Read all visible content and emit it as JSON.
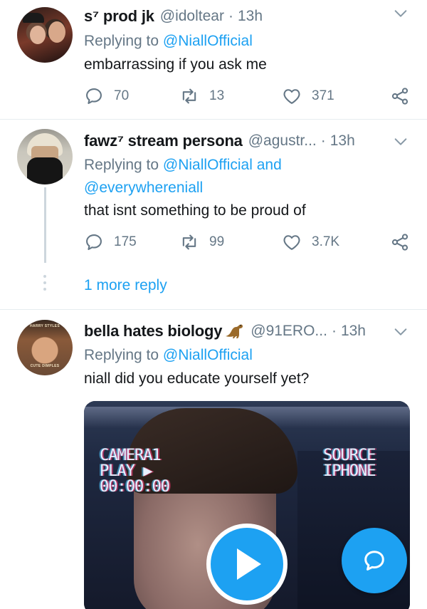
{
  "colors": {
    "accent": "#1da1f2",
    "secondary_text": "#657786",
    "primary_text": "#14171a"
  },
  "tweets": [
    {
      "name": "s⁷ prod jk",
      "handle": "@idoltear",
      "separator": "·",
      "time": "13h",
      "replying_prefix": "Replying to ",
      "replying_to": "@NiallOfficial",
      "text": "embarrassing if you ask me",
      "replies": "70",
      "retweets": "13",
      "likes": "371"
    },
    {
      "name": "fawz⁷ stream persona",
      "handle": "@agustr...",
      "separator": "·",
      "time": "13h",
      "replying_prefix": "Replying to ",
      "replying_to": "@NiallOfficial",
      "replying_joiner": " and",
      "replying_to_2": "@everywhereniall",
      "text": "that isnt something to be proud of",
      "replies": "175",
      "retweets": "99",
      "likes": "3.7K"
    },
    {
      "name": "bella hates biology",
      "name_emoji": "dinosaur-emoji",
      "handle": "@91ERO...",
      "separator": "·",
      "time": "13h",
      "replying_prefix": "Replying to ",
      "replying_to": "@NiallOfficial",
      "text": "niall did you educate yourself yet?",
      "avatar_text_top": "HARRY STYLES",
      "avatar_text_bottom": "CUTE DIMPLES"
    }
  ],
  "thread": {
    "more_reply_label": "1 more reply"
  },
  "media": {
    "camera_label": "CAMERA1",
    "play_label": "PLAY ▶",
    "timecode": "00:00:00",
    "source_label": "SOURCE",
    "source_value": "IPHONE"
  },
  "icons": [
    "reply-icon",
    "retweet-icon",
    "like-icon",
    "share-icon",
    "chevron-down-icon",
    "play-icon",
    "compose-reply-icon"
  ]
}
